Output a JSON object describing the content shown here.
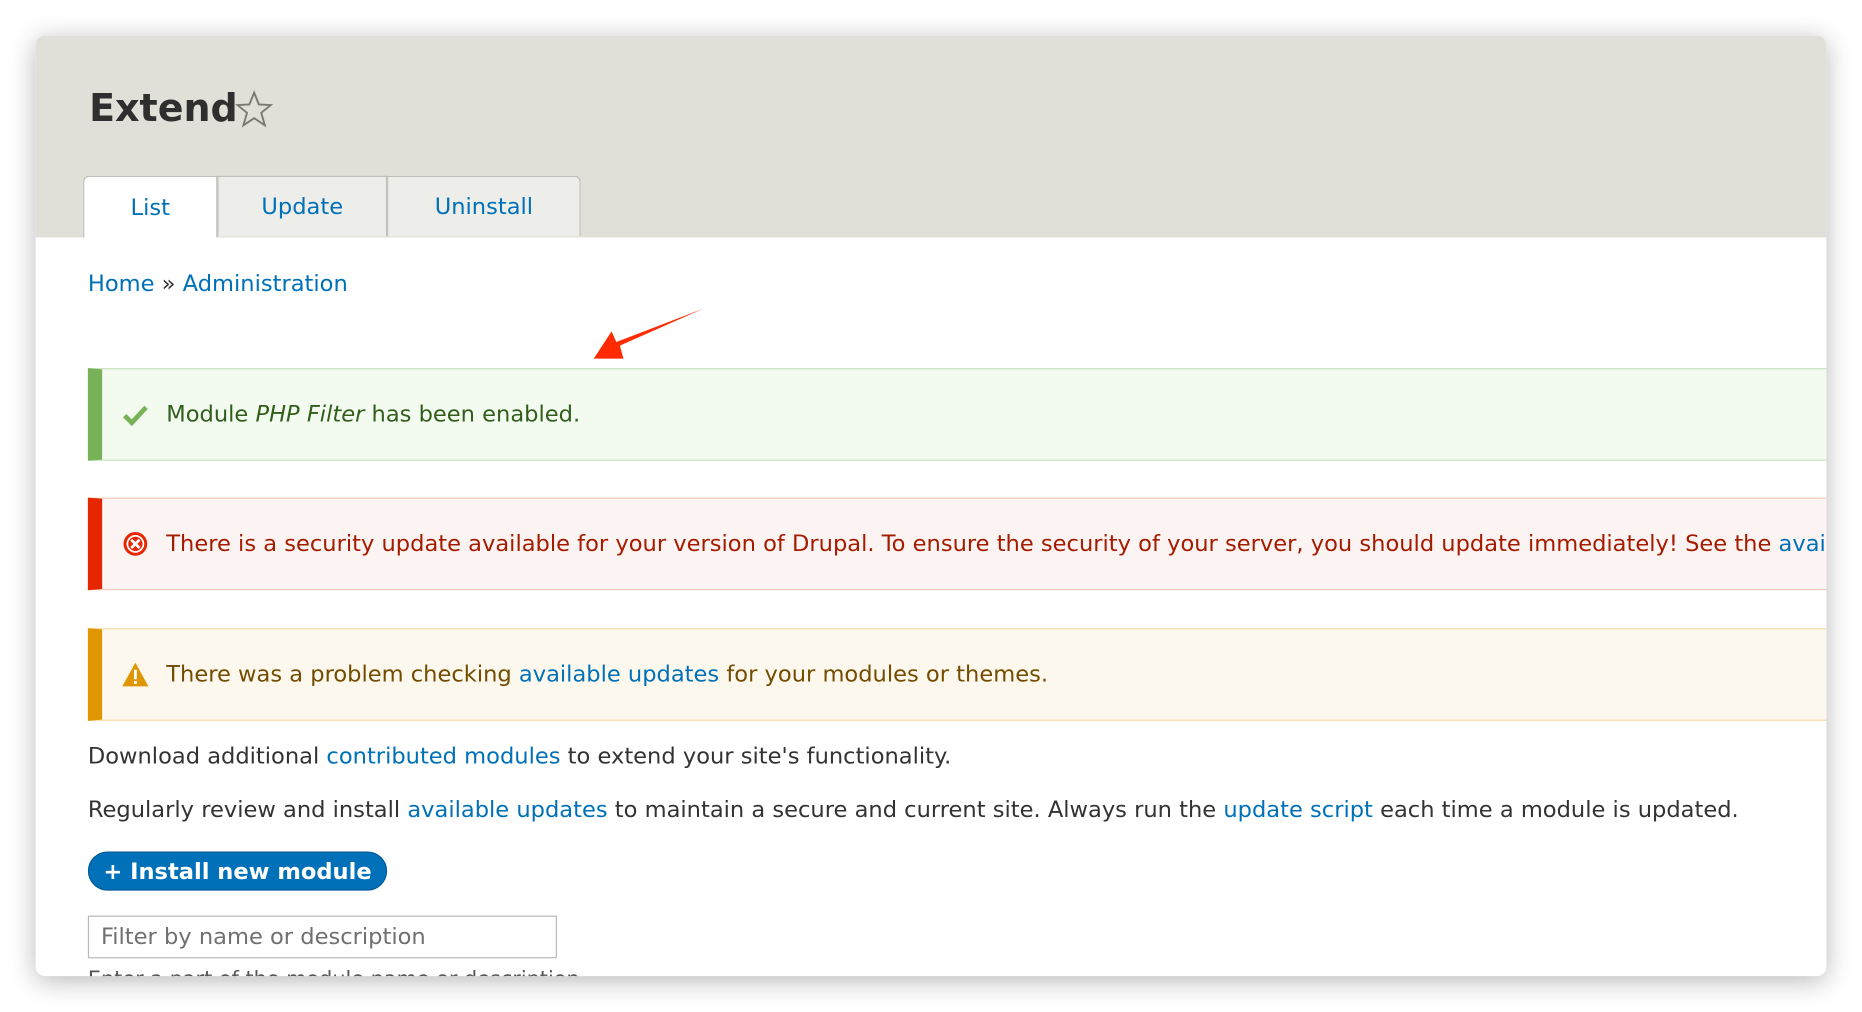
{
  "header": {
    "title": "Extend",
    "favorite_icon": "star-outline-icon"
  },
  "tabs": [
    {
      "label": "List",
      "active": true
    },
    {
      "label": "Update",
      "active": false
    },
    {
      "label": "Uninstall",
      "active": false
    }
  ],
  "breadcrumb": {
    "items": [
      "Home",
      "Administration"
    ],
    "separator": "»"
  },
  "messages": {
    "status": {
      "icon": "check-icon",
      "prefix": "Module ",
      "module": "PHP Filter",
      "suffix": " has been enabled.",
      "color": "#77b259"
    },
    "error": {
      "icon": "error-circle-icon",
      "text": "There is a security update available for your version of Drupal. To ensure the security of your server, you should update immediately! See the ",
      "link": "avail",
      "color": "#e62600"
    },
    "warning": {
      "icon": "warning-triangle-icon",
      "prefix": "There was a problem checking ",
      "link": "available updates",
      "suffix": " for your modules or themes.",
      "color": "#e09600"
    }
  },
  "intro": {
    "line1": {
      "prefix": "Download additional ",
      "link": "contributed modules",
      "suffix": " to extend your site's functionality."
    },
    "line2": {
      "prefix": "Regularly review and install ",
      "link1": "available updates",
      "middle": " to maintain a secure and current site. Always run the ",
      "link2": "update script",
      "suffix": " each time a module is updated."
    }
  },
  "install_button": {
    "label": "+ Install new module"
  },
  "filter": {
    "placeholder": "Filter by name or description",
    "value": "",
    "description": "Enter a part of the module name or description"
  },
  "annotation": {
    "icon": "red-arrow-icon",
    "color": "#ff2a00"
  },
  "colors": {
    "link": "#0071b8",
    "header_bg": "#e1e0d8"
  }
}
